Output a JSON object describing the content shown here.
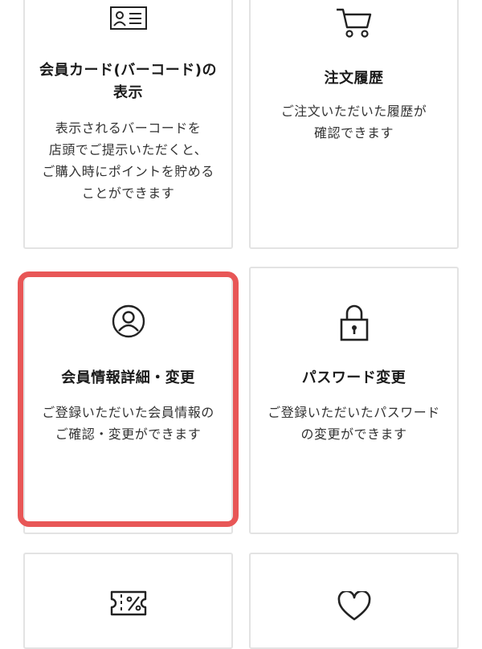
{
  "cards": [
    {
      "title_line1": "会員カード(バーコード)の",
      "title_line2": "表示",
      "desc": [
        "表示されるバーコードを",
        "店頭でご提示いただくと、",
        "ご購入時にポイントを貯める",
        "ことができます"
      ],
      "icon": "id-card-icon"
    },
    {
      "title": "注文履歴",
      "desc": [
        "ご注文いただいた履歴が",
        "確認できます"
      ],
      "icon": "shopping-cart-icon"
    },
    {
      "title": "会員情報詳細・変更",
      "desc": [
        "ご登録いただいた会員情報の",
        "ご確認・変更ができます"
      ],
      "icon": "user-circle-icon"
    },
    {
      "title": "パスワード変更",
      "desc": [
        "ご登録いただいたパスワード",
        "の変更ができます"
      ],
      "icon": "lock-icon"
    },
    {
      "icon": "coupon-icon"
    },
    {
      "icon": "heart-icon"
    }
  ],
  "colors": {
    "highlight": "#e85757",
    "card_border": "#e3e3e3",
    "text": "#1a1a1a"
  }
}
